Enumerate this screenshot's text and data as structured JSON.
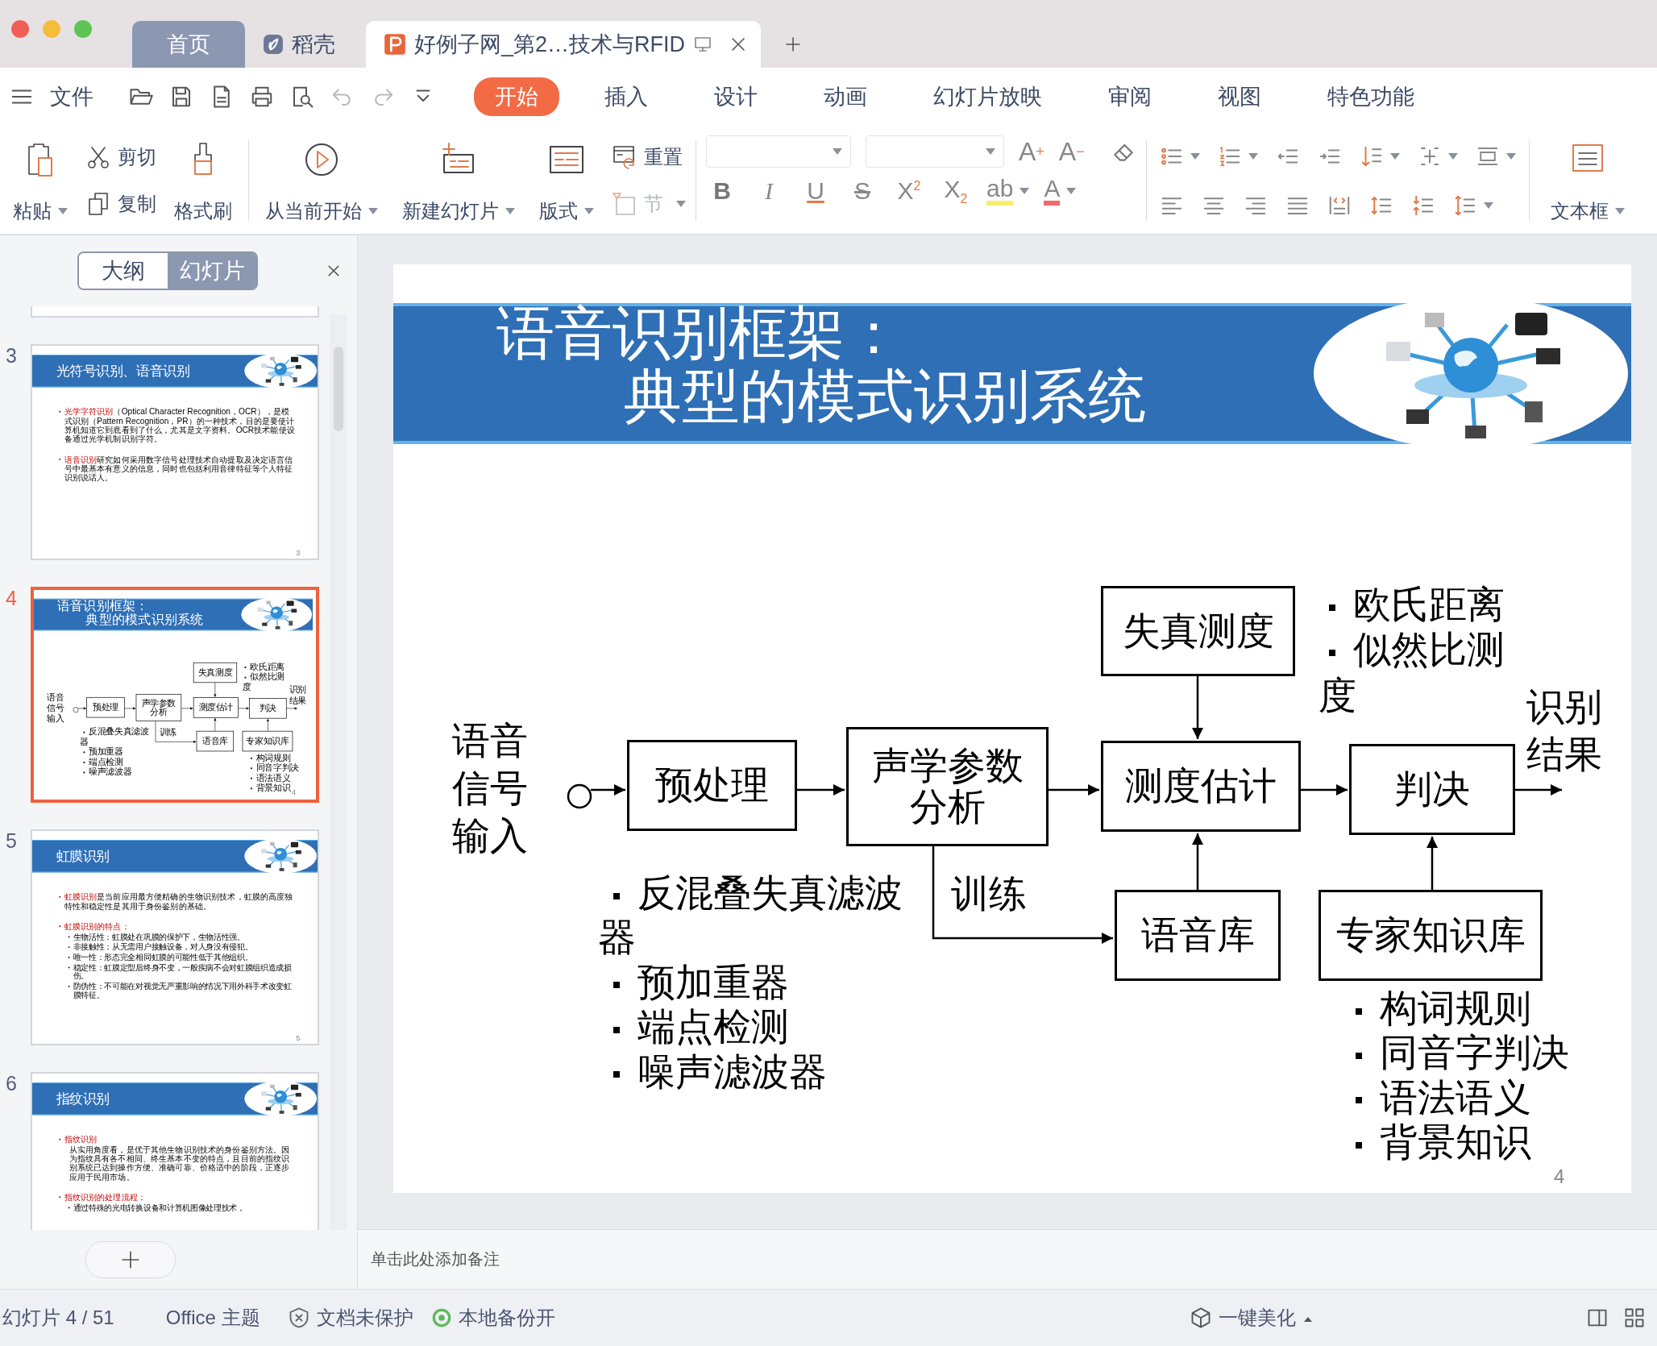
{
  "tabs": [
    {
      "label": "首页",
      "kind": "home",
      "selected": false
    },
    {
      "label": "稻壳",
      "kind": "store",
      "selected": false
    },
    {
      "label": "好例子网_第2…技术与RFID",
      "kind": "document",
      "selected": true
    }
  ],
  "menu": "文件",
  "quick_access": [
    {
      "disabled": false
    },
    {
      "disabled": false
    },
    {
      "disabled": false
    },
    {
      "disabled": false
    },
    {
      "disabled": false
    },
    {
      "disabled": true
    },
    {
      "disabled": true
    },
    {
      "disabled": false
    }
  ],
  "menu_tabs": [
    {
      "label": "开始",
      "selected": true
    },
    {
      "label": "插入",
      "selected": false
    },
    {
      "label": "设计",
      "selected": false
    },
    {
      "label": "动画",
      "selected": false
    },
    {
      "label": "幻灯片放映",
      "selected": false
    },
    {
      "label": "审阅",
      "selected": false
    },
    {
      "label": "视图",
      "selected": false
    },
    {
      "label": "特色功能",
      "selected": false
    }
  ],
  "ribbon": {
    "paste": "粘贴",
    "cut": "剪切",
    "copy": "复制",
    "format_painter": "格式刷",
    "play": "从当前开始",
    "new_slide": "新建幻灯片",
    "layout": "版式",
    "reset": "重置",
    "section": {
      "label": "节",
      "disabled": true
    },
    "size_buttons": [
      "A$^{+}$",
      "A$^{−}$"
    ],
    "format_buttons": [
      {
        "kind": "bold",
        "label": "B"
      },
      {
        "kind": "italic",
        "label": "I"
      },
      {
        "kind": "underline",
        "label": "U"
      },
      {
        "kind": "strike",
        "label": "S"
      },
      {
        "kind": "superscript",
        "label": "X$^{2}$"
      },
      {
        "kind": "subscript",
        "label": "X$_{2}$"
      },
      {
        "kind": "highlight",
        "label": "ab"
      },
      {
        "kind": "font_color",
        "label": "A"
      }
    ],
    "text_box": "文本框"
  },
  "side_panel": {
    "tabs": [
      {
        "label": "大纲",
        "selected": false
      },
      {
        "label": "幻灯片",
        "selected": true
      }
    ],
    "thumbnails": [
      {
        "number": "3",
        "selected": false,
        "slide": {
          "kind": "bullets",
          "title": [
            "光符号识别、语音识别"
          ],
          "page": "3",
          "bullets": [
            {
              "lead": "光学字符识别",
              "text": "（Optical Character Recognition，OCR），是模式识别（Pattern Recognition，PR）的一种技术，目的是要使计算机知道它到底看到了什么，尤其是文字资料。OCR技术能使设备通过光学机制识别字符。"
            },
            {
              "lead": "语音识别",
              "text": "研究如何采用数字信号处理技术自动提取及决定语言信号中最基本有意义的信息，同时也包括利用音律特征等个人特征识别说话人。"
            }
          ]
        }
      },
      {
        "number": "4",
        "selected": true,
        "slide": {
          "kind": "diagram",
          "title": [
            "语音识别框架：",
            "典型的模式识别系统"
          ],
          "page": "4",
          "diagram": {
            "input": "语音信号输入",
            "output": "识别结果",
            "training": "训练",
            "blocks": [
              "预处理",
              "声学参数分析",
              "失真测度",
              "测度估计",
              "判决",
              "语音库",
              "专家知识库"
            ],
            "distortion_notes": [
              "欧氏距离",
              "似然比测度"
            ],
            "preprocessing_notes": [
              "反混叠失真滤波器",
              "预加重器",
              "端点检测",
              "噪声滤波器"
            ],
            "knowledge_notes": [
              "构词规则",
              "同音字判决",
              "语法语义",
              "背景知识"
            ]
          }
        }
      },
      {
        "number": "5",
        "selected": false,
        "slide": {
          "kind": "bullets",
          "title": [
            "虹膜识别"
          ],
          "page": "5",
          "bullets": [
            {
              "lead": "虹膜识别",
              "text": "是当前应用最方便精确的生物识别技术，虹膜的高度独特性和稳定性是其用于身份鉴别的基础。"
            },
            {
              "lead": "虹膜识别的特点：",
              "children": [
                {
                  "kind": "sub",
                  "text": "生物活性：虹膜处在巩膜的保护下，生物活性强。"
                },
                {
                  "kind": "sub",
                  "text": "非接触性：从无需用户接触设备，对人身没有侵犯。"
                },
                {
                  "kind": "sub",
                  "text": "唯一性：形态完全相同虹膜的可能性低于其他组织。"
                },
                {
                  "kind": "sub",
                  "text": "稳定性：虹膜定型后终身不变，一般疾病不会对虹膜组织造成损伤。"
                },
                {
                  "kind": "sub",
                  "text": "防伪性：不可能在对视觉无严重影响的情况下用外科手术改变虹膜特征。"
                }
              ]
            }
          ]
        }
      },
      {
        "number": "6",
        "selected": false,
        "slide": {
          "kind": "bullets",
          "title": [
            "指纹识别"
          ],
          "bullets": [
            {
              "lead": "指纹识别",
              "children": [
                {
                  "kind": "plain",
                  "text": "从实用角度看，是优于其他生物识别技术的身份鉴别方法。因为指纹具有各不相同、终生基本不变的特点，且目前的指纹识别系统已达到操作方便、准确可靠、价格适中的阶段，正逐步应用于民用市场。"
                }
              ]
            },
            {
              "lead": "指纹识别的处理流程：",
              "children": [
                {
                  "kind": "sub",
                  "text": "通过特殊的光电转换设备和计算机图像处理技术，"
                }
              ]
            }
          ]
        }
      }
    ]
  },
  "slide": {
    "kind": "diagram",
    "title": [
      "语音识别框架：",
      "典型的模式识别系统"
    ],
    "page": "4",
    "diagram": {
      "input": "语音信号输入",
      "output": "识别结果",
      "training": "训练",
      "blocks": [
        "预处理",
        "声学参数分析",
        "失真测度",
        "测度估计",
        "判决",
        "语音库",
        "专家知识库"
      ],
      "distortion_notes": [
        "欧氏距离",
        "似然比测度"
      ],
      "preprocessing_notes": [
        "反混叠失真滤波器",
        "预加重器",
        "端点检测",
        "噪声滤波器"
      ],
      "knowledge_notes": [
        "构词规则",
        "同音字判决",
        "语法语义",
        "背景知识"
      ]
    }
  },
  "notes": {
    "placeholder": "单击此处添加备注"
  },
  "status_bar": {
    "slide_info": "幻灯片 4 / 51",
    "theme": "Office 主题",
    "protection": "文档未保护",
    "backup": {
      "label": "本地备份开",
      "on": true
    },
    "beautify": "一键美化"
  }
}
